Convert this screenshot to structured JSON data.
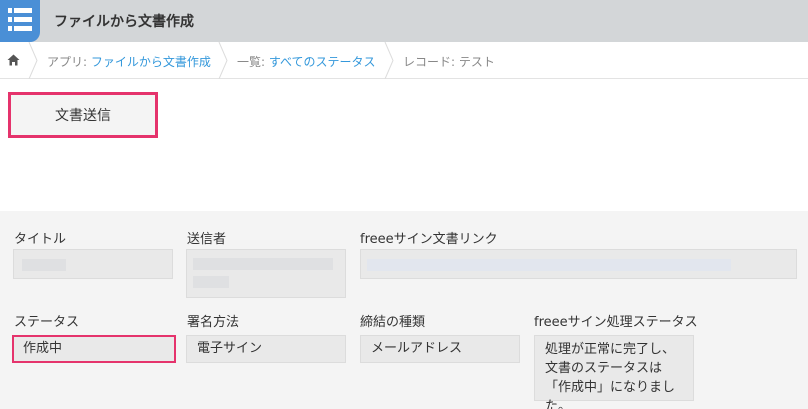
{
  "app": {
    "title": "ファイルから文書作成",
    "icon": "list-icon",
    "accent": "#4a8fd6"
  },
  "breadcrumb": {
    "home_icon": "home-icon",
    "app_prefix": "アプリ: ",
    "app_link": "ファイルから文書作成",
    "list_prefix": "一覧: ",
    "list_link": "すべてのステータス",
    "record": "レコード: テスト"
  },
  "actions": {
    "send_label": "文書送信"
  },
  "fields": {
    "title": {
      "label": "タイトル",
      "value": ""
    },
    "sender": {
      "label": "送信者",
      "value": ""
    },
    "doc_link": {
      "label": "freeeサイン文書リンク",
      "value": ""
    },
    "status": {
      "label": "ステータス",
      "value": "作成中"
    },
    "sign_method": {
      "label": "署名方法",
      "value": "電子サイン"
    },
    "contract_type": {
      "label": "締結の種類",
      "value": "メールアドレス"
    },
    "process_status": {
      "label": "freeeサイン処理ステータス",
      "value": "処理が正常に完了し、文書のステータスは「作成中」になりました。"
    }
  },
  "colors": {
    "highlight": "#e5336c",
    "link": "#3498db"
  }
}
